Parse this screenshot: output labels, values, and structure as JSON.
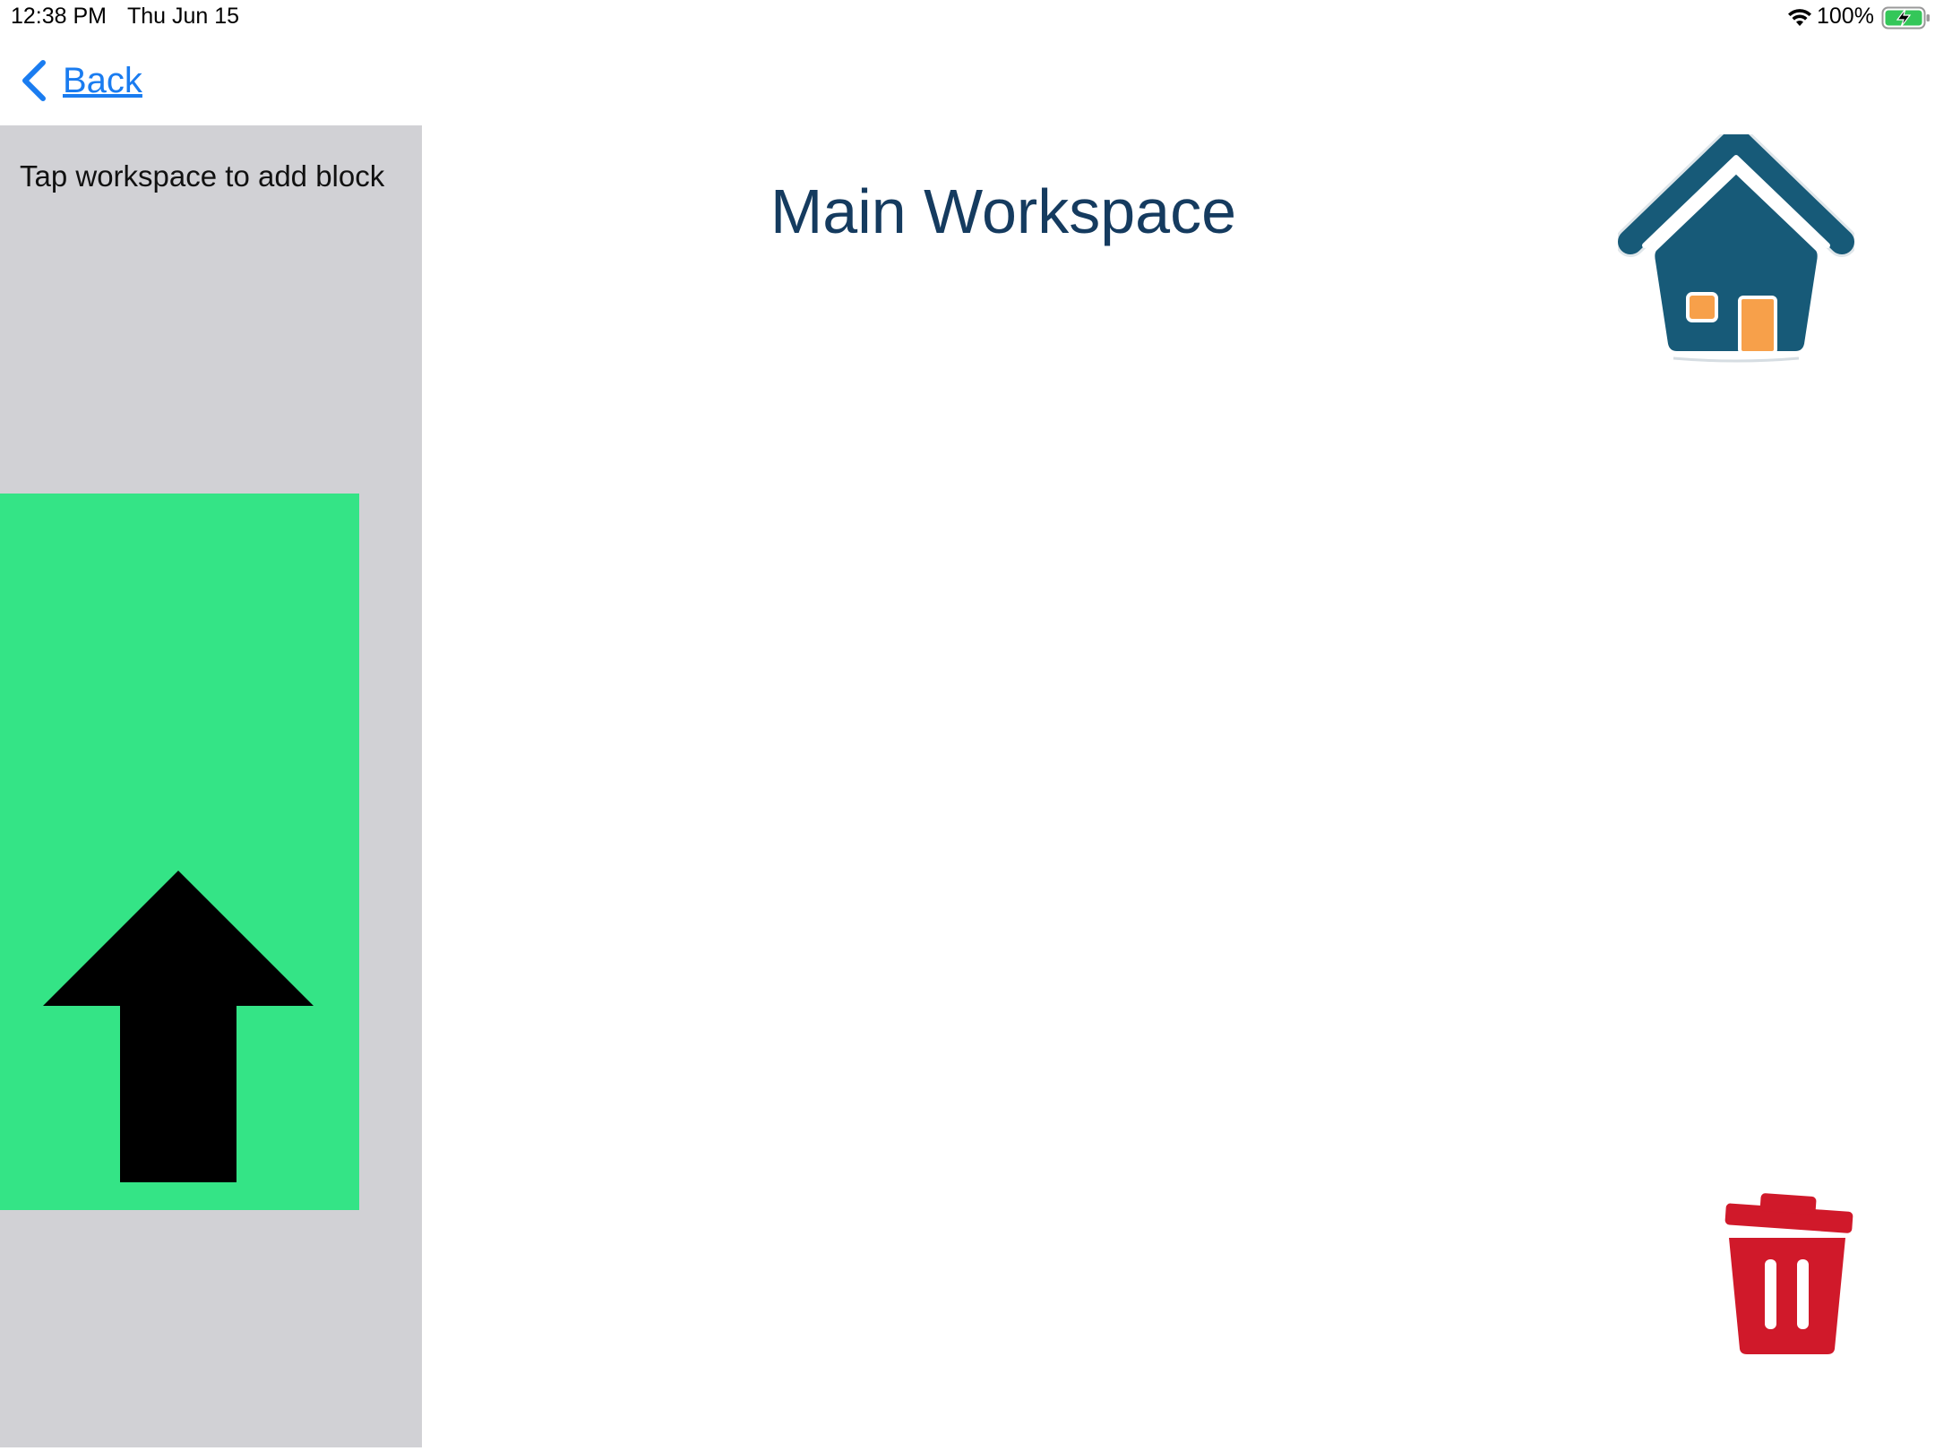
{
  "status_bar": {
    "time": "12:38 PM",
    "date": "Thu Jun 15",
    "battery_percent": "100%",
    "wifi_icon": "wifi-icon",
    "battery_icon": "battery-charging-icon"
  },
  "nav": {
    "back_label": "Back",
    "back_icon": "chevron-left-icon"
  },
  "sidebar": {
    "hint": "Tap workspace to add block",
    "block": {
      "icon": "arrow-up-icon",
      "color": "#34e486"
    }
  },
  "main": {
    "title": "Main Workspace",
    "home_icon": "home-icon",
    "trash_icon": "trash-icon"
  },
  "colors": {
    "accent": "#1a7cf0",
    "title": "#153b5f",
    "sidebar_bg": "#d1d1d5",
    "home_roof": "#175a78",
    "home_window": "#f7a04a",
    "trash": "#d0192a"
  }
}
